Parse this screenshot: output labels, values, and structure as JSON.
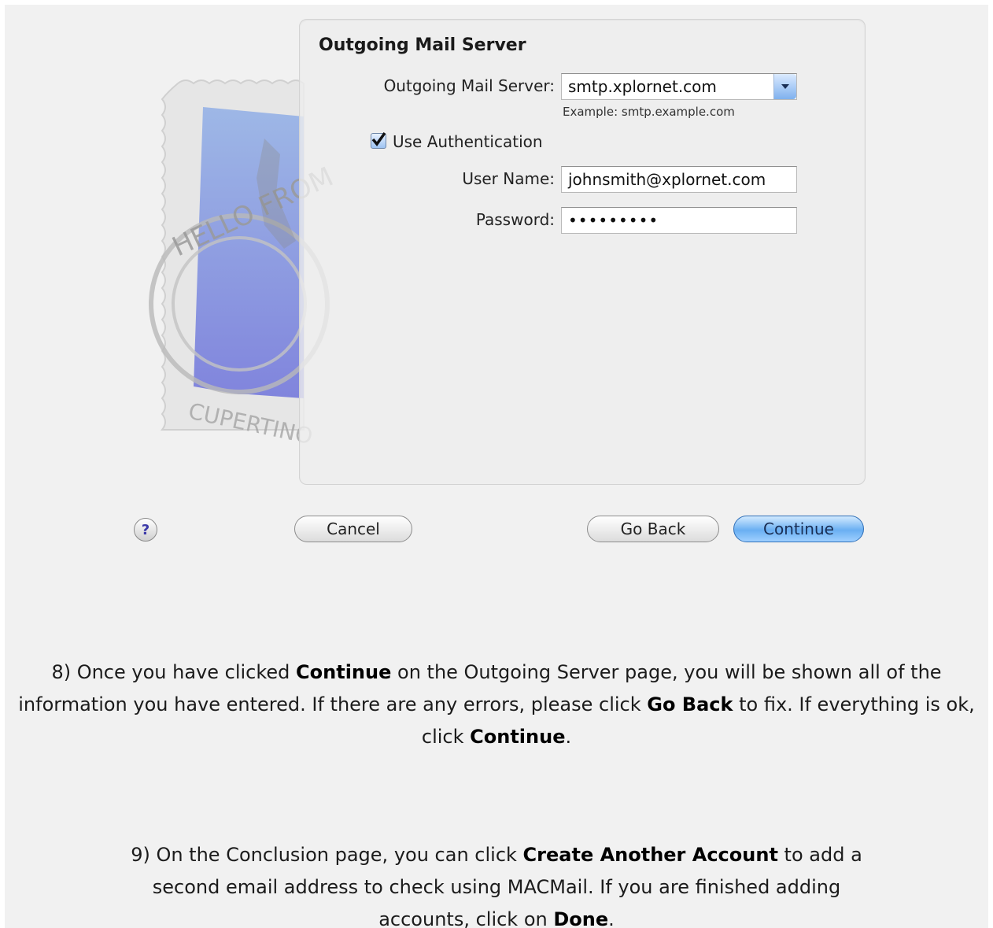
{
  "dialog": {
    "title": "Outgoing Mail Server",
    "fields": {
      "server_label": "Outgoing Mail Server:",
      "server_value": "smtp.xplornet.com",
      "server_example": "Example: smtp.example.com",
      "auth_label": "Use Authentication",
      "auth_checked": true,
      "username_label": "User Name:",
      "username_value": "johnsmith@xplornet.com",
      "password_label": "Password:",
      "password_value": "•••••••••"
    },
    "stamp": {
      "text_top": "HELLO FROM",
      "text_bottom": "CUPERTINO"
    },
    "buttons": {
      "help": "?",
      "cancel": "Cancel",
      "go_back": "Go Back",
      "continue": "Continue"
    }
  },
  "instructions": {
    "step8": {
      "p1": "8) Once you have clicked ",
      "b1": "Continue",
      "p2": " on the Outgoing Server page, you will be shown all of the information you have entered. If there are any errors, please click ",
      "b2": "Go Back",
      "p3": " to fix. If everything is ok, click ",
      "b3": "Continue",
      "p4": "."
    },
    "step9": {
      "p1": "9) On the Conclusion page, you can click ",
      "b1": "Create Another Account",
      "p2": " to add a second email address to check using MACMail. If you are finished adding accounts, click on ",
      "b2": "Done",
      "p3": "."
    }
  },
  "colors": {
    "page_bg": "#f1f1f1",
    "primary_button": "#6aaff2",
    "stamp_blue": "#7f86e0"
  }
}
